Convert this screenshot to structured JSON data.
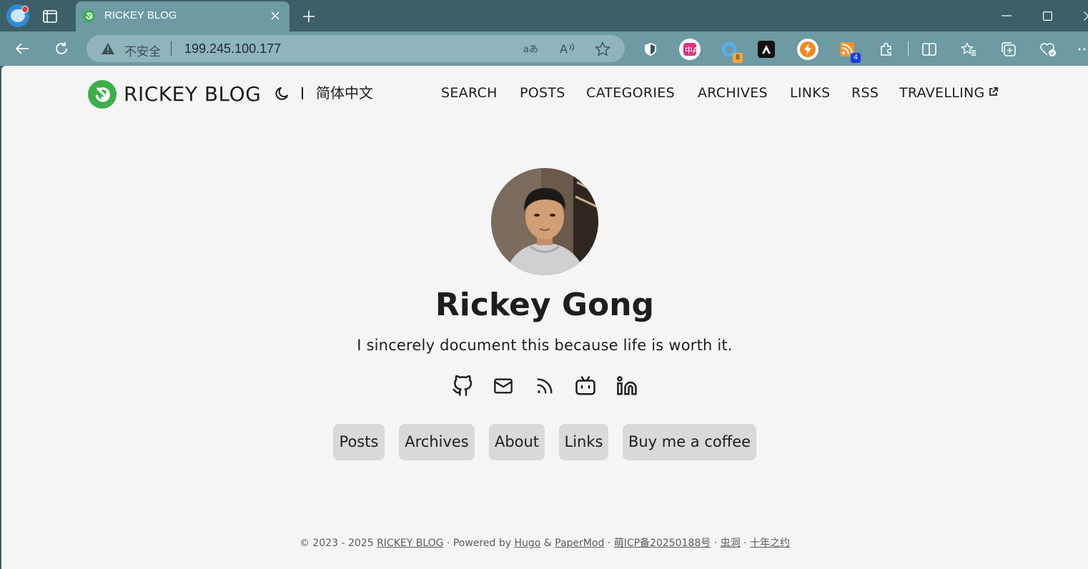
{
  "browser": {
    "tab_title": "RICKEY BLOG",
    "insecure_label": "不安全",
    "url": "199.245.100.177",
    "extension_badges": {
      "ext_ring": "8",
      "ext_rss": "4"
    }
  },
  "site": {
    "title": "RICKEY BLOG",
    "language": "简体中文",
    "nav": [
      {
        "label": "SEARCH"
      },
      {
        "label": "POSTS"
      },
      {
        "label": "CATEGORIES"
      },
      {
        "label": "ARCHIVES"
      },
      {
        "label": "LINKS"
      },
      {
        "label": "RSS"
      },
      {
        "label": "TRAVELLING",
        "external": true
      }
    ]
  },
  "profile": {
    "name": "Rickey Gong",
    "motto": "I sincerely document this because life is worth it.",
    "social_icons": [
      "github-icon",
      "mail-icon",
      "rss-icon",
      "bilibili-icon",
      "linkedin-icon"
    ],
    "buttons": [
      "Posts",
      "Archives",
      "About",
      "Links",
      "Buy me a coffee"
    ]
  },
  "footer": {
    "prefix": "© 2023 - 2025 ",
    "site_link": "RICKEY BLOG",
    "powered": " · Powered by ",
    "hugo": "Hugo",
    "amp": " & ",
    "papermod": "PaperMod",
    "dot1": " · ",
    "icp": "萌ICP备20250188号",
    "dot2": " · ",
    "wormhole": "虫洞",
    "dot3": " · ",
    "decade": "十年之约"
  },
  "colors": {
    "tabbar": "#3d5f68",
    "toolbar": "#6d9aa3",
    "page_bg": "#f5f5f5",
    "button_bg": "#d9d9d9",
    "logo_green": "#3bb04a"
  }
}
